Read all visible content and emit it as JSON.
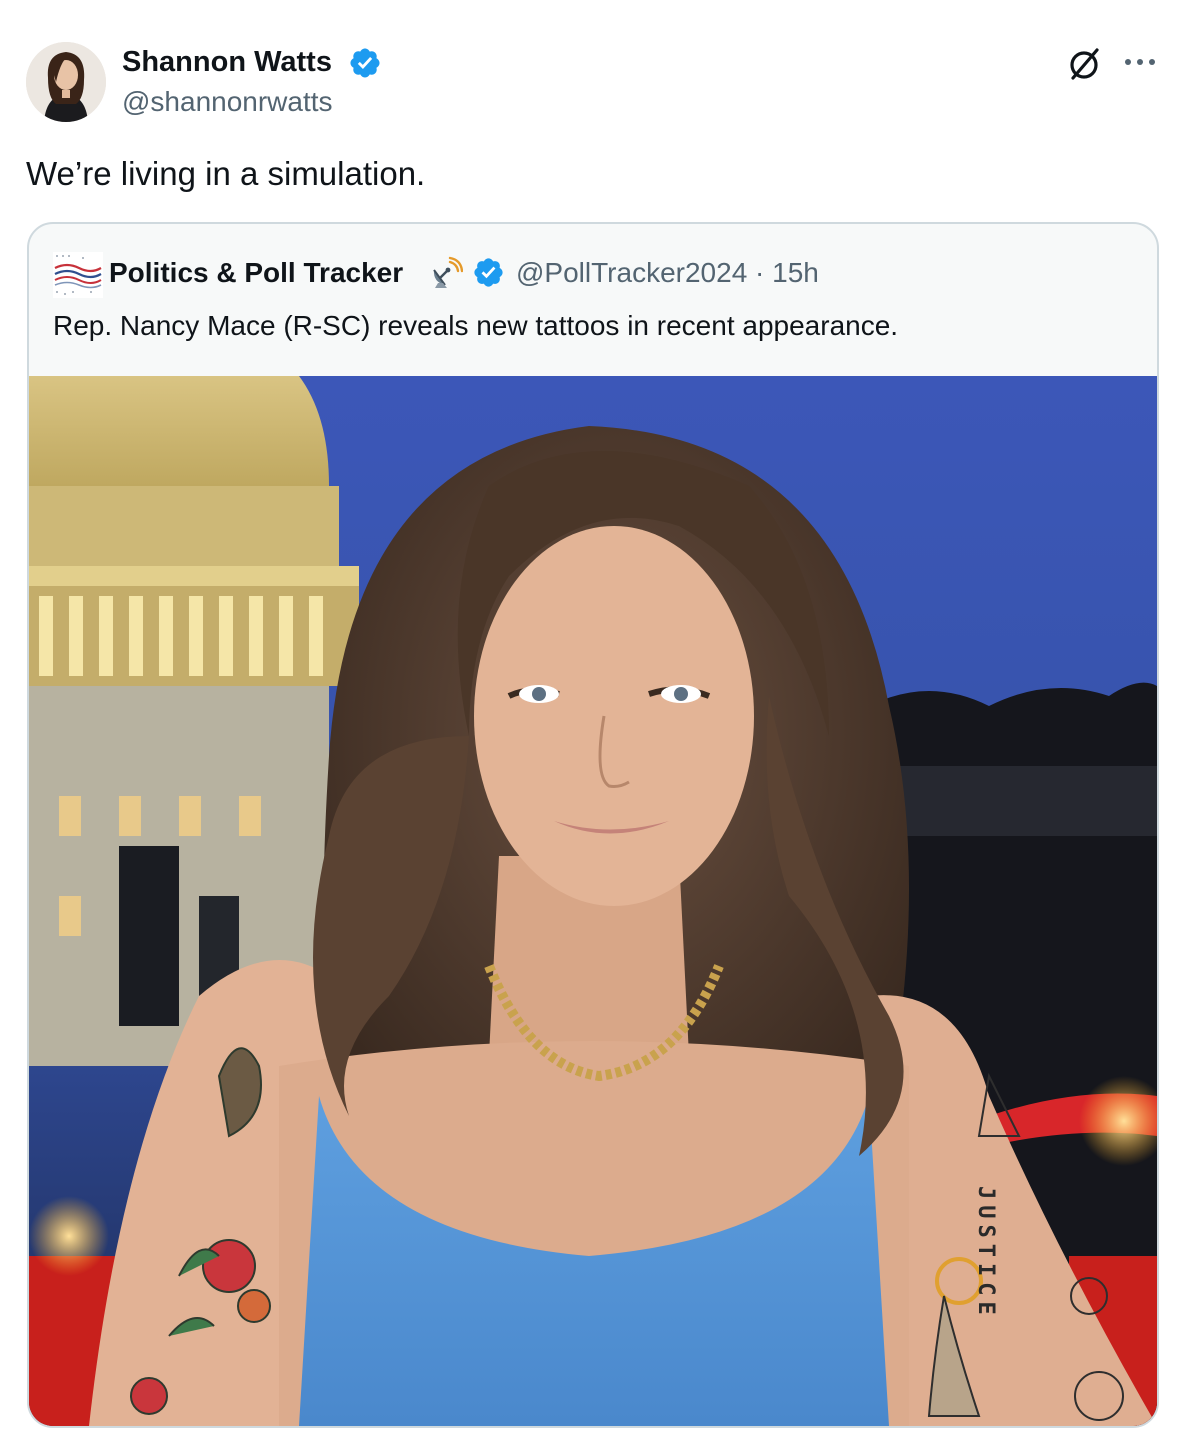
{
  "tweet": {
    "author": {
      "name": "Shannon Watts",
      "handle": "@shannonrwatts",
      "verified": true
    },
    "text": "We’re living in a simulation.",
    "icons": {
      "grok": "grok-icon",
      "more": "more-icon"
    },
    "quoted": {
      "author": {
        "name": "Politics & Poll Tracker",
        "handle": "@PollTracker2024",
        "verified": true,
        "emoji": "satellite-antenna-icon"
      },
      "meta": "@PollTracker2024 · 15h",
      "text": "Rep. Nancy Mace (R-SC) reveals new tattoos in recent appearance.",
      "media": {
        "type": "photo",
        "tattoo_text": "JUSTICE"
      }
    }
  },
  "colors": {
    "verified": "#1d9bf0",
    "text": "#0f1419",
    "secondary": "#536471",
    "border": "#cfd9de"
  }
}
